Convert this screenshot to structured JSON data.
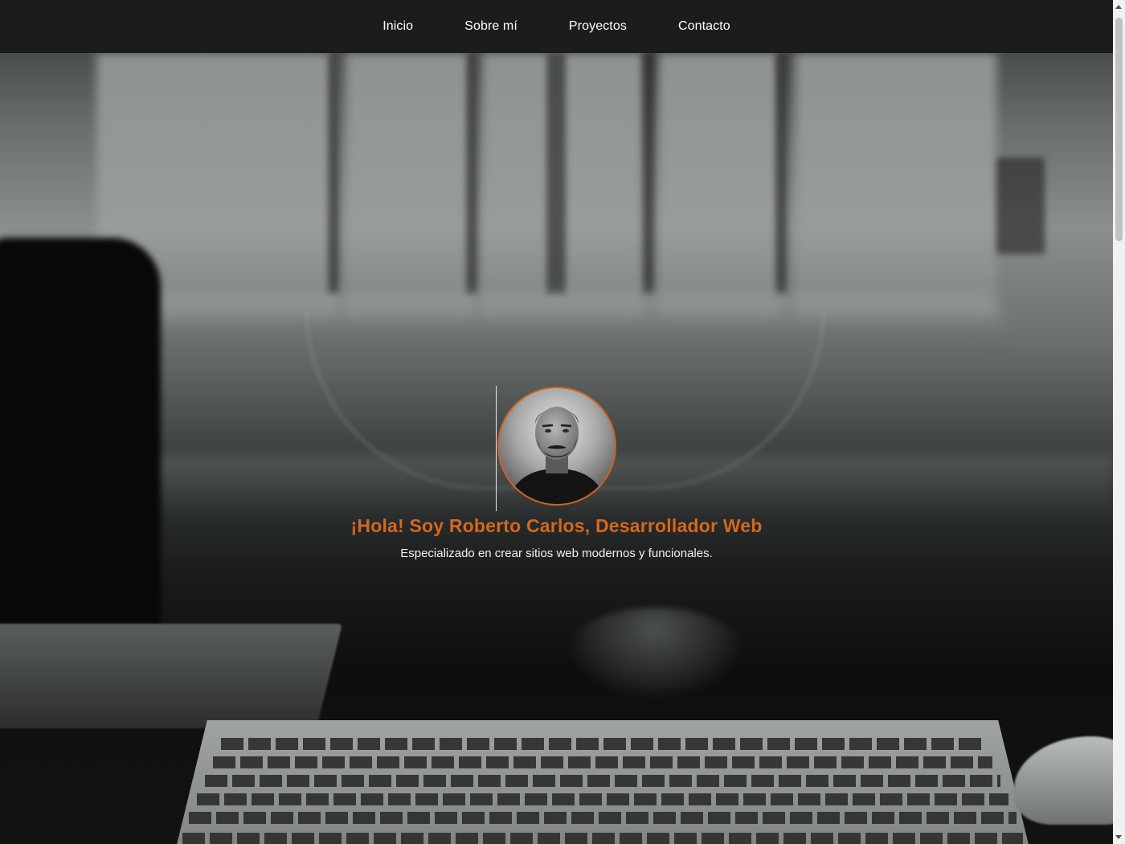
{
  "nav": {
    "items": [
      {
        "label": "Inicio"
      },
      {
        "label": "Sobre mí"
      },
      {
        "label": "Proyectos"
      },
      {
        "label": "Contacto"
      }
    ]
  },
  "hero": {
    "title": "¡Hola! Soy Roberto Carlos, Desarrollador Web",
    "subtitle": "Especializado en crear sitios web modernos y funcionales."
  },
  "colors": {
    "accent": "#d4681e",
    "navbar_bg": "#1e1c1a",
    "nav_text": "#ffffff"
  },
  "icons": {
    "avatar": "profile-photo"
  }
}
